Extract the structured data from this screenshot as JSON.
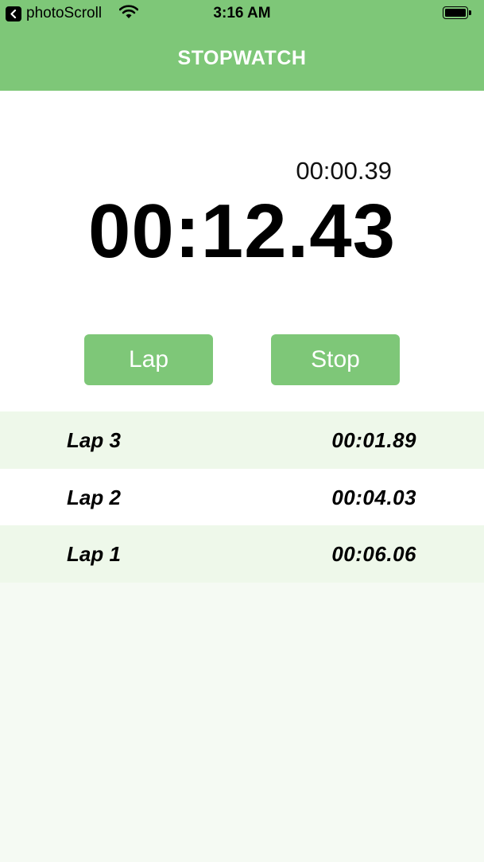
{
  "status_bar": {
    "back_app": "photoScroll",
    "time": "3:16 AM",
    "battery_level": 1.0
  },
  "nav": {
    "title": "STOPWATCH"
  },
  "timer": {
    "lap_time": "00:00.39",
    "total_time": "00:12.43"
  },
  "buttons": {
    "lap_label": "Lap",
    "stop_label": "Stop"
  },
  "laps": [
    {
      "name": "Lap 3",
      "time": "00:01.89"
    },
    {
      "name": "Lap 2",
      "time": "00:04.03"
    },
    {
      "name": "Lap 1",
      "time": "00:06.06"
    }
  ],
  "colors": {
    "accent": "#7ec778",
    "row_tint": "#eef8ea",
    "background": "#f5faf3"
  },
  "icons": {
    "back": "chevron-left-icon",
    "wifi": "wifi-icon",
    "battery": "battery-icon"
  }
}
